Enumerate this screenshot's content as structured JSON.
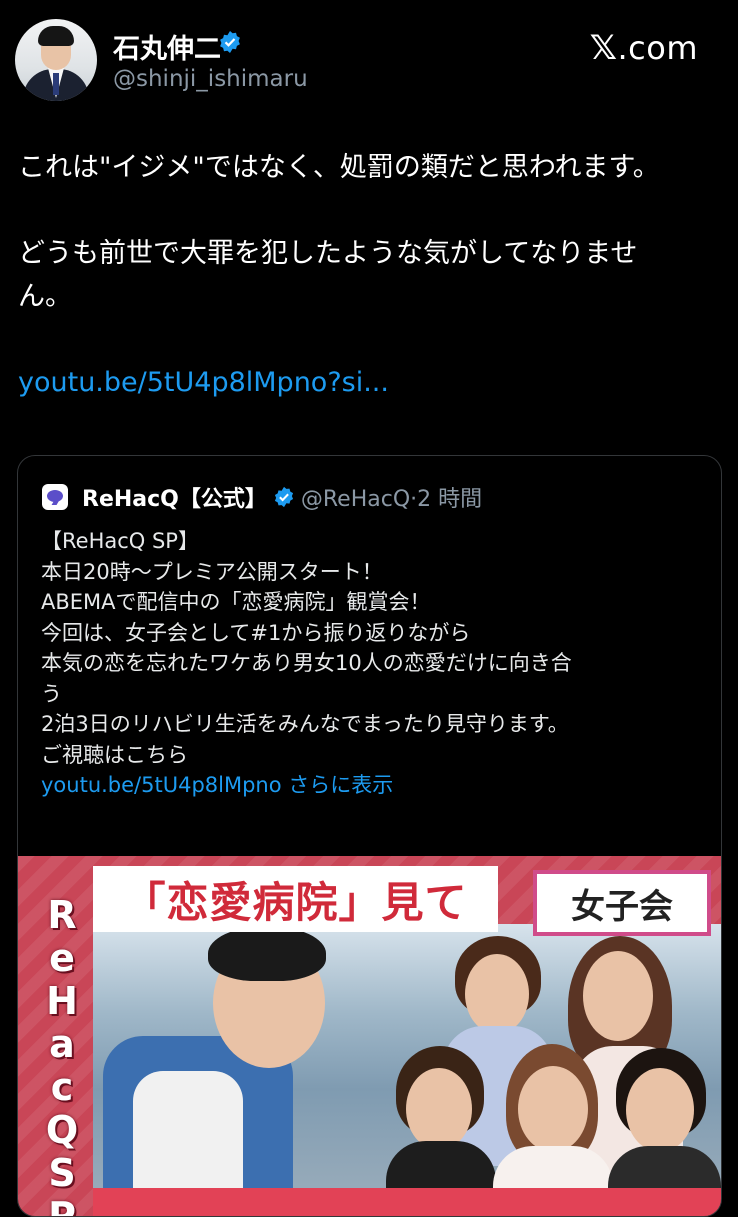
{
  "author": {
    "name": "石丸伸二",
    "handle": "@shinji_ishimaru",
    "verified_icon": "verified-badge-icon"
  },
  "site_logo": {
    "x": "𝕏",
    "rest": ".com"
  },
  "tweet": {
    "line1": "これは\"イジメ\"ではなく、処罰の類だと思われます。",
    "line2": "どうも前世で大罪を犯したような気がしてなりませ",
    "line3": "ん。",
    "link": "youtu.be/5tU4p8lMpno?si..."
  },
  "quote": {
    "name": "ReHacQ【公式】",
    "meta": "@ReHacQ·2 時間",
    "lines": [
      "【ReHacQ SP】",
      "本日20時〜プレミア公開スタート！",
      "ABEMAで配信中の「恋愛病院」観賞会！",
      "今回は、女子会として#1から振り返りながら",
      "本気の恋を忘れたワケあり男女10人の恋愛だけに向き合",
      "う",
      "2泊3日のリハビリ生活をみんなでまったり見守ります。",
      "ご視聴はこちら"
    ],
    "link": "youtu.be/5tU4p8lMpno",
    "show_more": "さらに表示"
  },
  "thumbnail": {
    "vertical_text": "ReHacQ SP",
    "title": "「恋愛病院」見て",
    "badge": "女子会"
  },
  "colors": {
    "link": "#1d9bf0",
    "verified": "#1d9bf0",
    "background": "#000000",
    "muted": "#8b98a5",
    "thumb_red": "#c94657"
  }
}
